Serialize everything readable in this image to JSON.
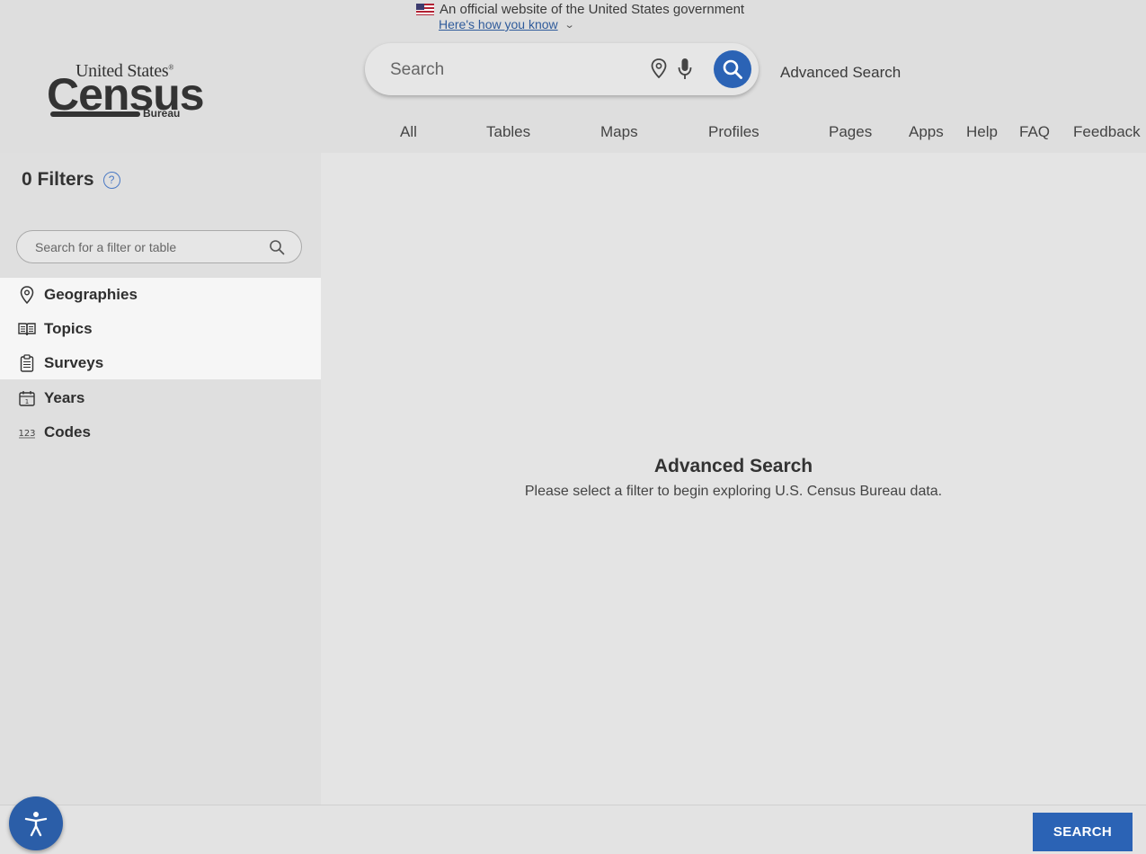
{
  "gov_banner": {
    "official_text": "An official website of the United States government",
    "how_link": "Here's how you know"
  },
  "logo": {
    "line1": "United States",
    "line2": "Census",
    "line3": "Bureau"
  },
  "header": {
    "search_placeholder": "Search",
    "advanced_search_link": "Advanced Search",
    "tabs": [
      "All",
      "Tables",
      "Maps",
      "Profiles",
      "Pages",
      "Apps",
      "Help",
      "FAQ",
      "Feedback"
    ]
  },
  "sidebar": {
    "filters_title": "0 Filters",
    "filter_search_placeholder": "Search for a filter or table",
    "items": [
      {
        "label": "Geographies",
        "icon": "map-pin-icon"
      },
      {
        "label": "Topics",
        "icon": "open-book-icon"
      },
      {
        "label": "Surveys",
        "icon": "clipboard-icon"
      },
      {
        "label": "Years",
        "icon": "calendar-icon"
      },
      {
        "label": "Codes",
        "icon": "numbers-123-icon"
      }
    ]
  },
  "main": {
    "title": "Advanced Search",
    "subtitle": "Please select a filter to begin exploring U.S. Census Bureau data."
  },
  "footer": {
    "search_button": "SEARCH"
  },
  "colors": {
    "accent_blue": "#2b63b5",
    "link_blue": "#2f5b9b",
    "highlight_bg": "#f6f6f6"
  }
}
